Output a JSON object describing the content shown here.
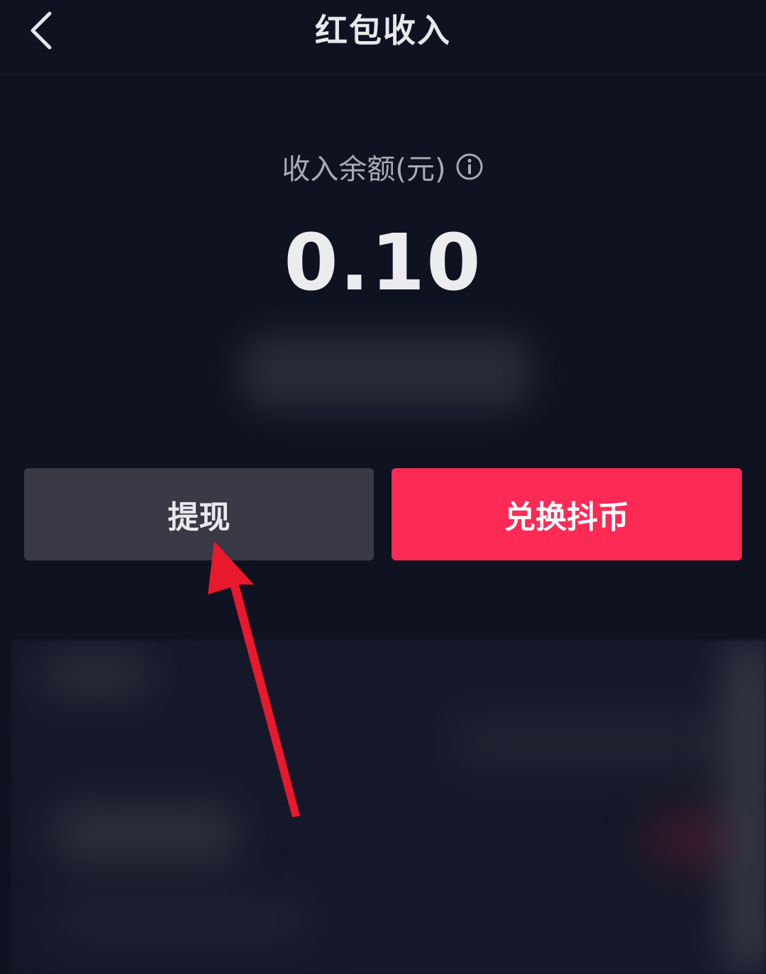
{
  "header": {
    "title": "红包收入",
    "back_icon": "chevron-left-icon"
  },
  "balance": {
    "label": "收入余额(元)",
    "info_icon": "info-icon",
    "value": "0.10"
  },
  "actions": {
    "withdraw_label": "提现",
    "exchange_label": "兑换抖币"
  },
  "colors": {
    "background": "#0f1221",
    "withdraw_button": "#393a45",
    "exchange_button": "#fc2a55",
    "annotation_arrow": "#e8192c"
  }
}
